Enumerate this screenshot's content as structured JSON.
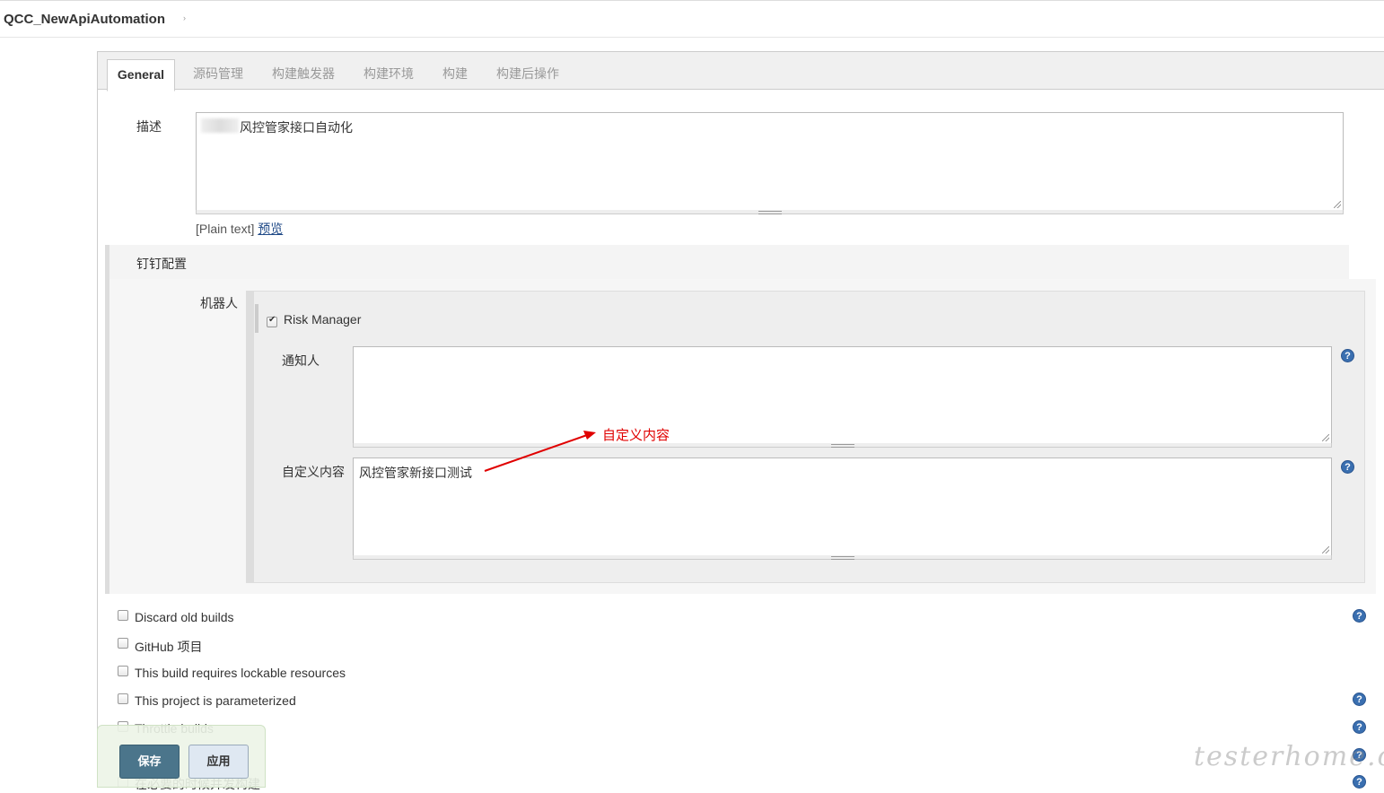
{
  "breadcrumb": {
    "job_name": "QCC_NewApiAutomation",
    "separator": "›"
  },
  "tabs": [
    {
      "label": "General",
      "active": true
    },
    {
      "label": "源码管理"
    },
    {
      "label": "构建触发器"
    },
    {
      "label": "构建环境"
    },
    {
      "label": "构建"
    },
    {
      "label": "构建后操作"
    }
  ],
  "description": {
    "label": "描述",
    "value": "风控管家接口自动化",
    "format_label": "[Plain text]",
    "preview_link": "预览"
  },
  "dingtalk": {
    "section_label": "钉钉配置",
    "robot_label": "机器人",
    "robot_name": "Risk Manager",
    "robot_checked": true,
    "notify_label": "通知人",
    "notify_value": "",
    "custom_label": "自定义内容",
    "custom_value": "风控管家新接口测试"
  },
  "annotation": {
    "text": "自定义内容",
    "color": "#e00000"
  },
  "options": [
    {
      "label": "Discard old builds",
      "checked": false,
      "help": true
    },
    {
      "label": "GitHub 项目",
      "checked": false,
      "help": false
    },
    {
      "label": "This build requires lockable resources",
      "checked": false,
      "help": false
    },
    {
      "label": "This project is parameterized",
      "checked": false,
      "help": true
    },
    {
      "label": "Throttle builds",
      "checked": false,
      "help": true
    },
    {
      "label": "在必要的时候并发构建",
      "checked": false,
      "help": true
    }
  ],
  "buttons": {
    "save": "保存",
    "apply": "应用"
  },
  "help_icon": "?",
  "watermark": "testerhome.com",
  "colors": {
    "save_button": "#4b758b",
    "help_icon": "#3a6fb0",
    "annotation": "#e00000"
  }
}
